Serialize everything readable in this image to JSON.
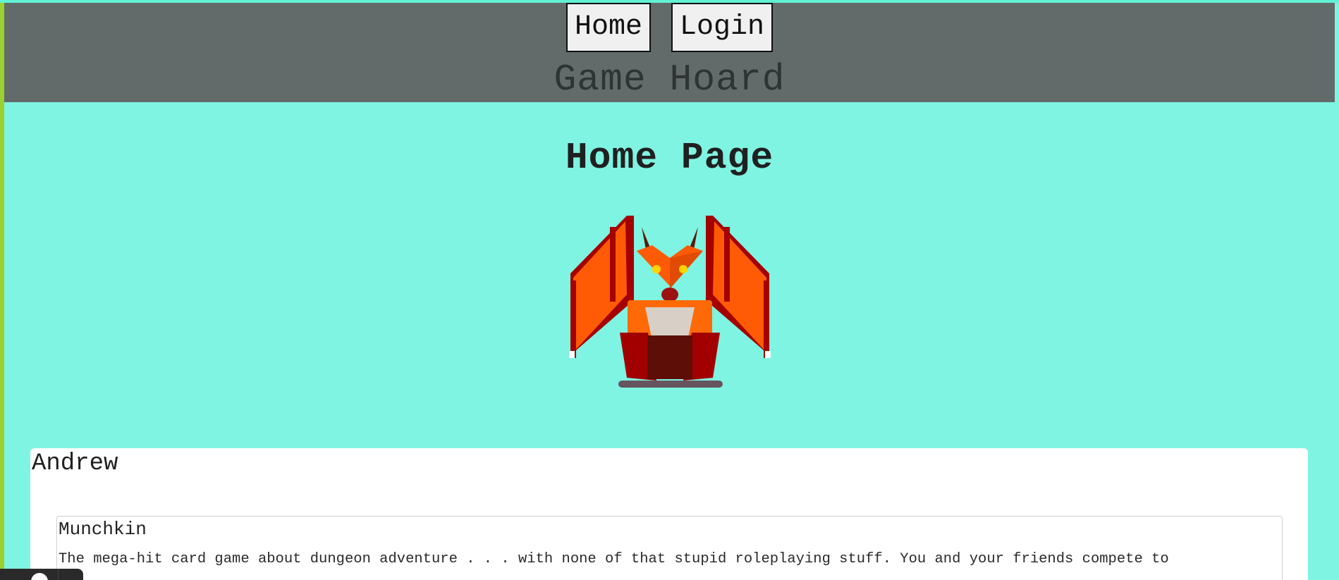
{
  "nav": {
    "home_label": "Home",
    "login_label": "Login"
  },
  "header": {
    "site_title": "Game Hoard"
  },
  "main": {
    "page_title": "Home Page",
    "hero_image": "dragon-illustration"
  },
  "cards": [
    {
      "owner": "Andrew",
      "games": [
        {
          "title": "Munchkin",
          "description": "The mega-hit card game about dungeon adventure . . . with none of that stupid roleplaying stuff. You and your friends compete to"
        }
      ]
    }
  ],
  "colors": {
    "page_background": "#7ff4e2",
    "header_background": "#626a6a",
    "left_accent": "#9ad02f",
    "dragon_primary": "#ff5a06",
    "dragon_dark": "#a50000",
    "dragon_belly": "#d9d1c7"
  }
}
